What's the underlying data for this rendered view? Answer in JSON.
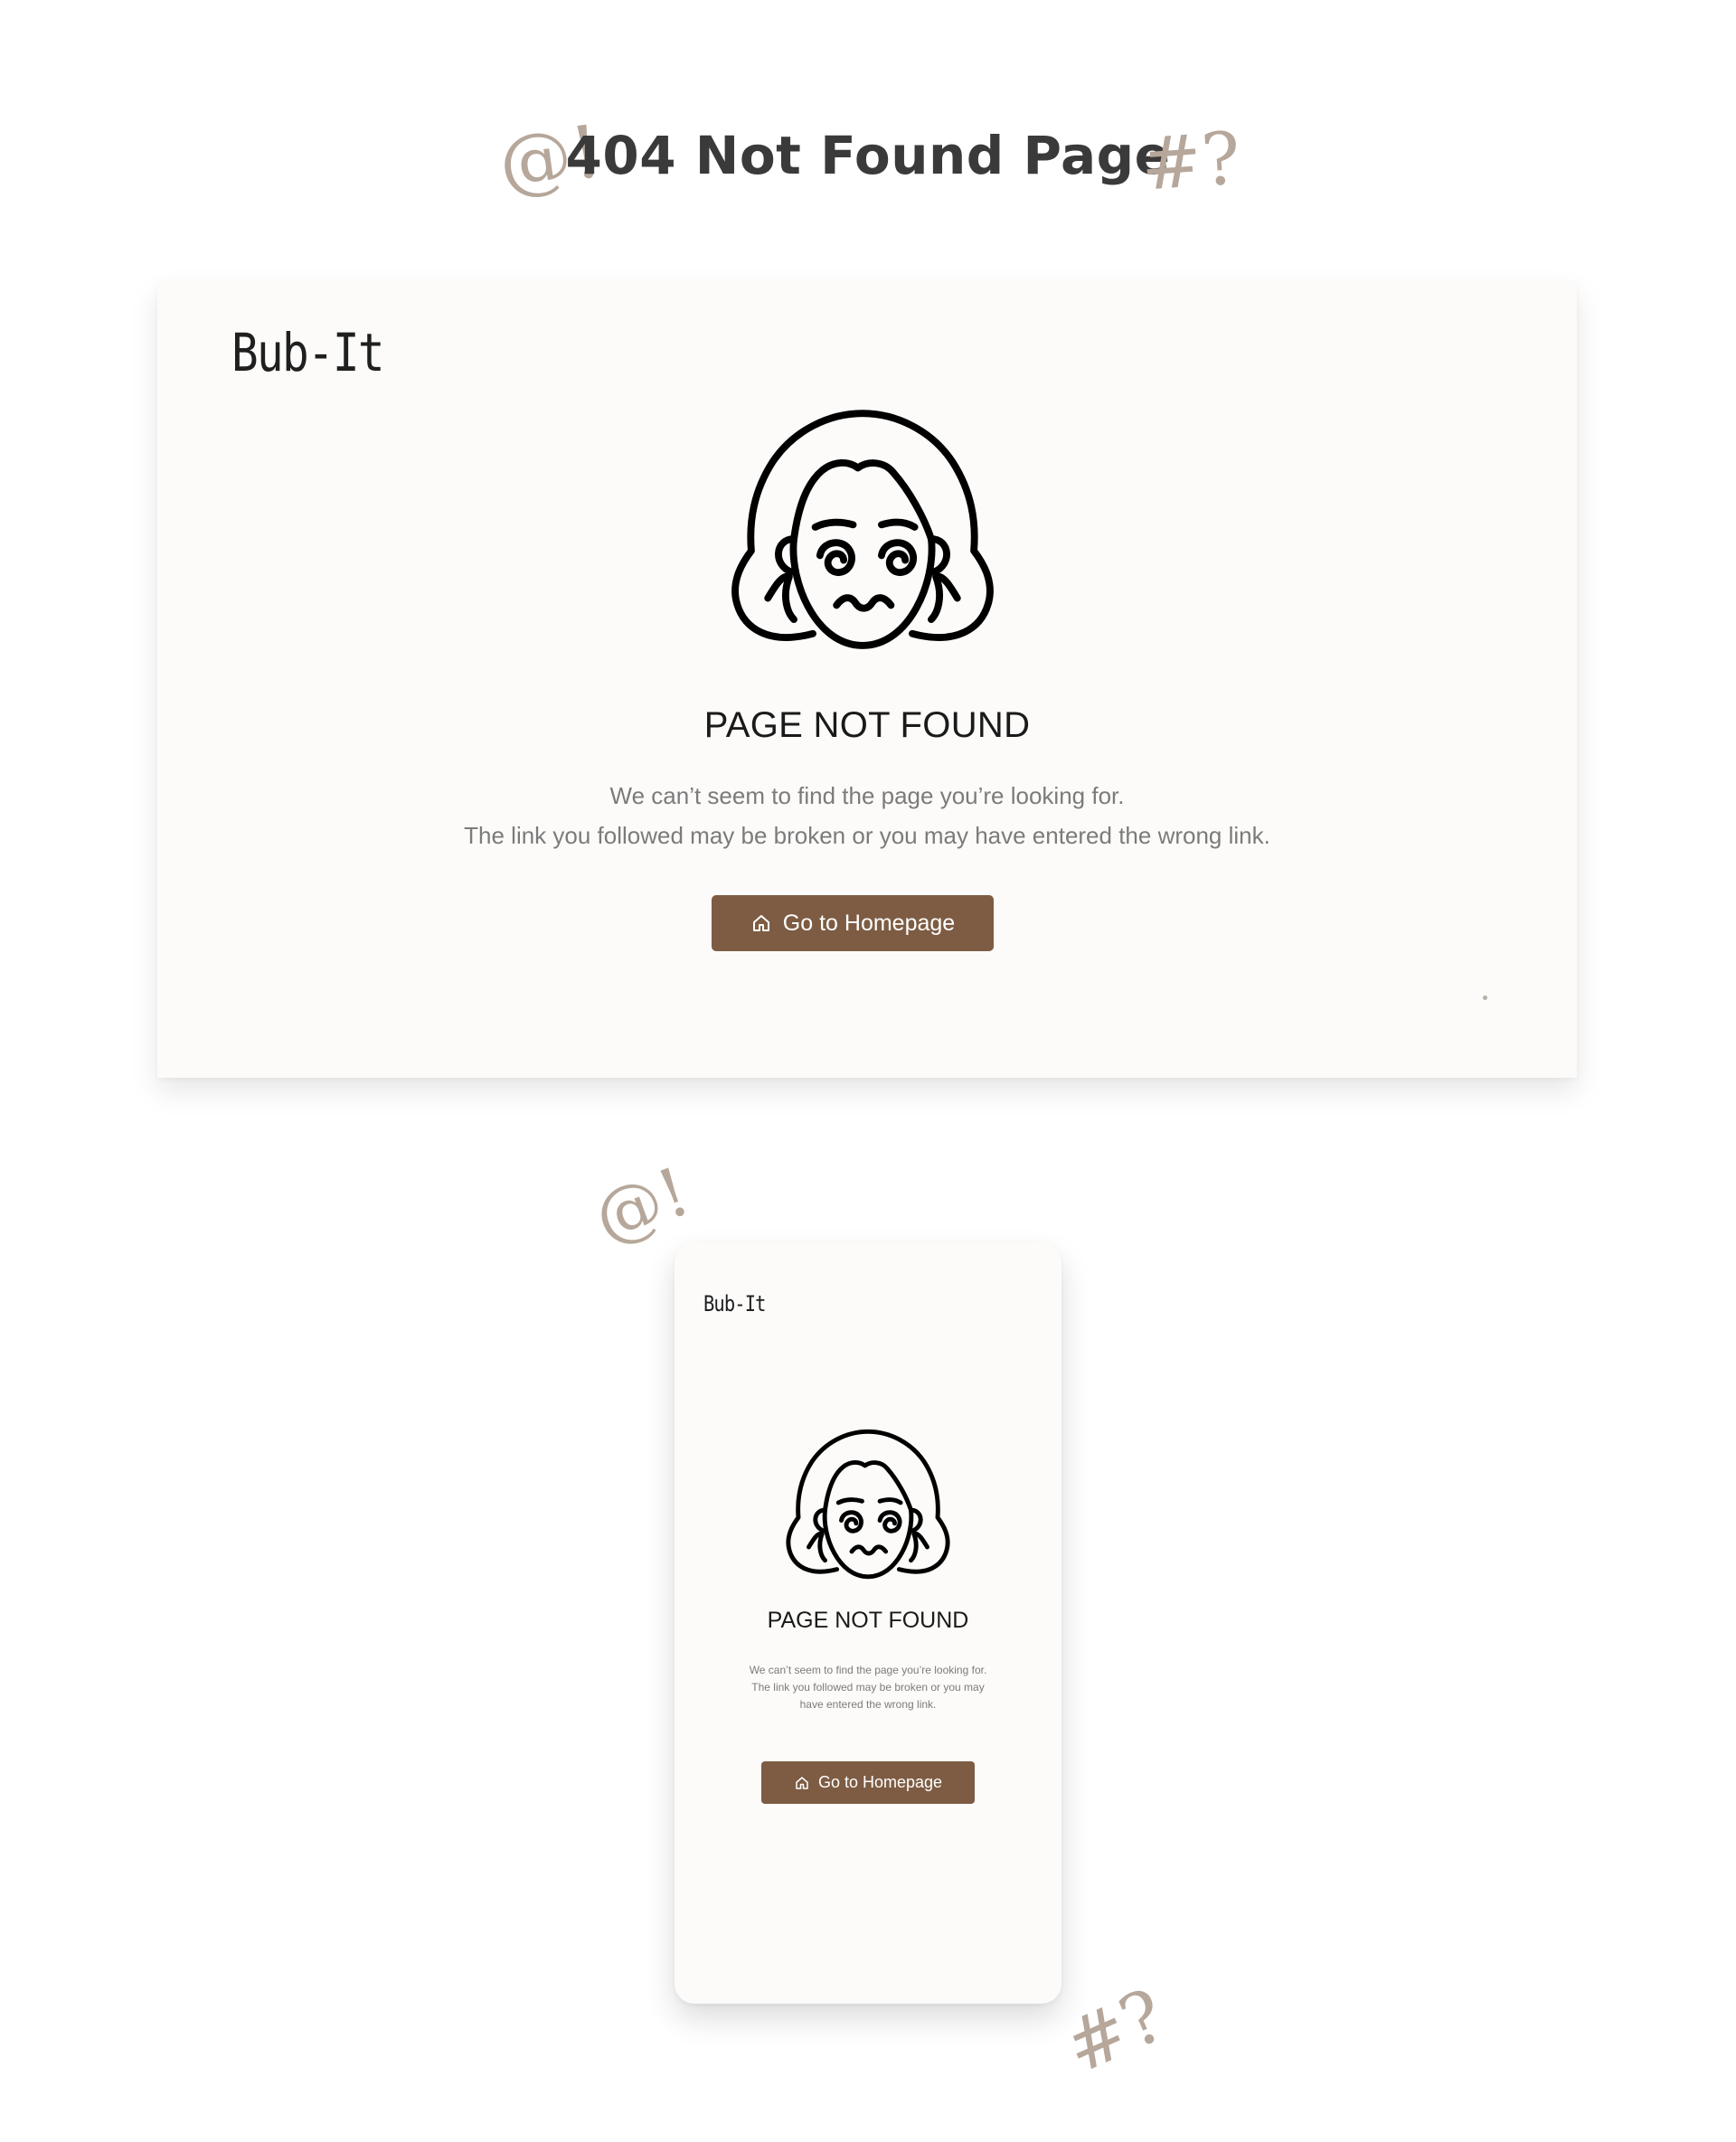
{
  "heading": {
    "title": "404 Not Found Page",
    "doodle_left": "@!",
    "doodle_right": "#?"
  },
  "desktop": {
    "logo": "Bub-It",
    "title": "PAGE NOT FOUND",
    "description_line1": "We can’t seem to find the page you’re looking for.",
    "description_line2": "The link you followed may be broken or you may have entered the wrong link.",
    "button_label": "Go to Homepage",
    "button_icon": "home-icon",
    "illustration": "dizzy-face-icon"
  },
  "mobile": {
    "logo": "Bub-It",
    "title": "PAGE NOT FOUND",
    "description_line1": "We can’t seem to find the page you’re looking for.",
    "description_line2": "The link you followed may be broken or you may",
    "description_line3": "have entered the wrong link.",
    "button_label": "Go to Homepage",
    "button_icon": "home-icon",
    "doodle_top": "@!",
    "doodle_bottom": "#?"
  },
  "colors": {
    "accent": "#7d5c43",
    "card_bg": "#fcfbf9",
    "doodle": "#b6a79a",
    "text_muted": "#7b7b7b"
  }
}
